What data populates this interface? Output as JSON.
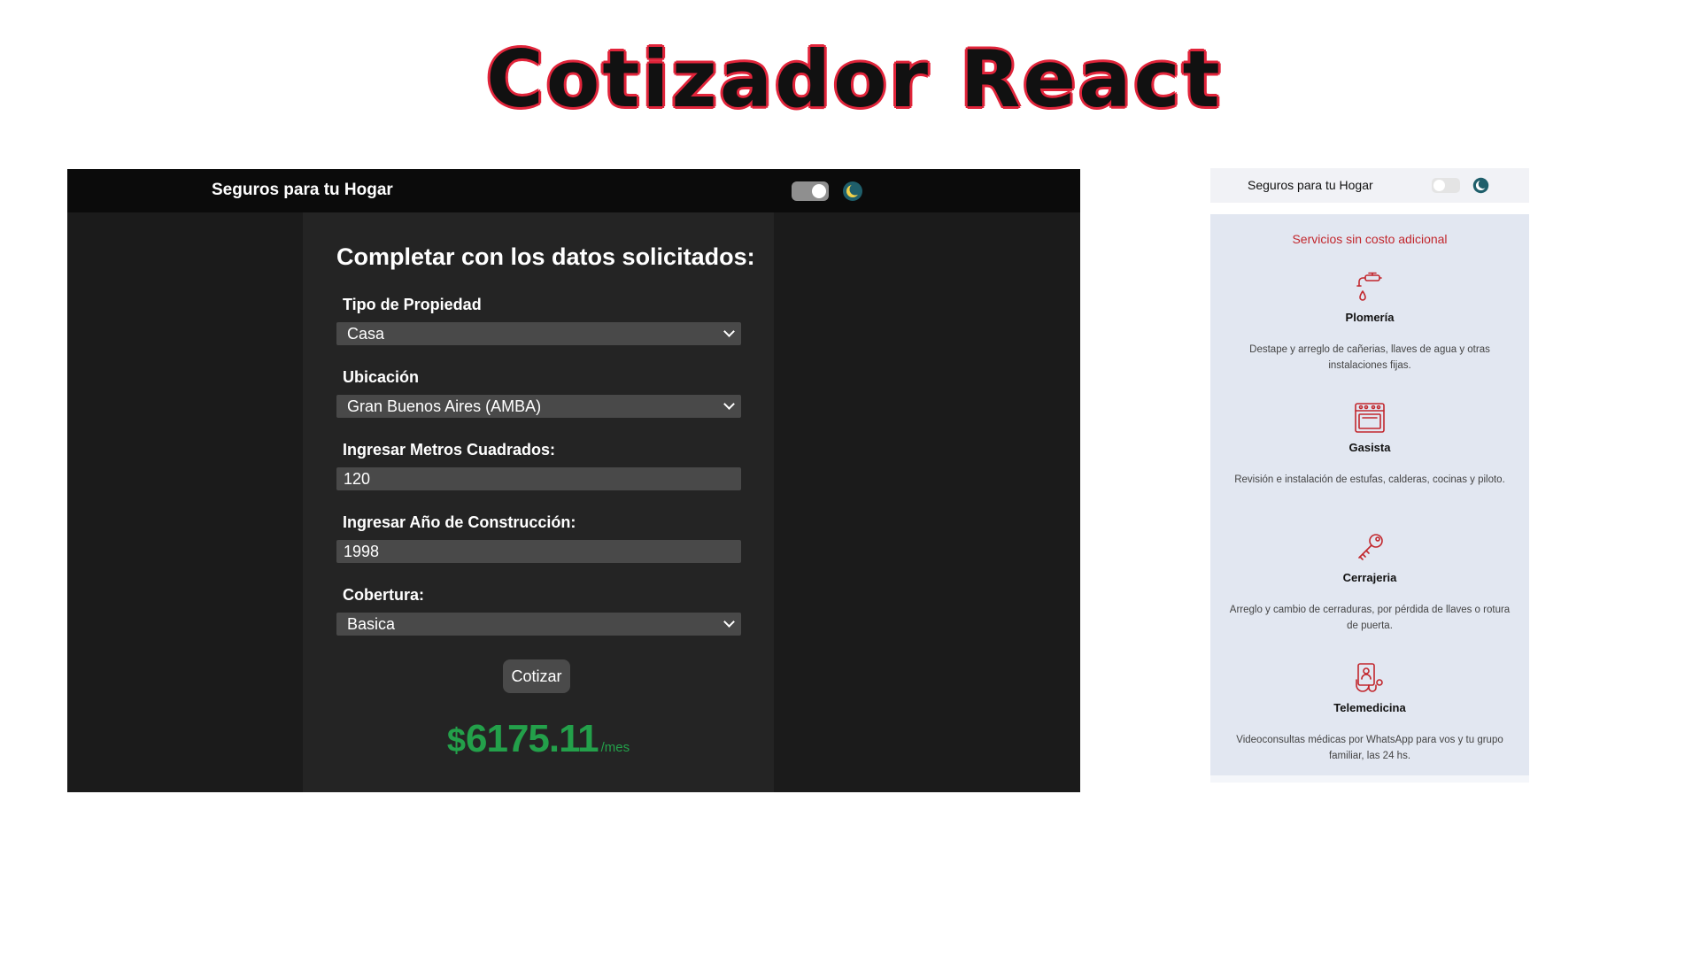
{
  "page_title": "Cotizador React",
  "dark_app": {
    "brand": "Seguros para tu Hogar",
    "form_title": "Completar con los datos solicitados:",
    "fields": [
      {
        "label": "Tipo de Propiedad",
        "value": "Casa",
        "kind": "select"
      },
      {
        "label": "Ubicación",
        "value": "Gran Buenos Aires (AMBA)",
        "kind": "select"
      },
      {
        "label": "Ingresar Metros Cuadrados:",
        "value": "120",
        "kind": "input"
      },
      {
        "label": "Ingresar Año de Construcción:",
        "value": "1998",
        "kind": "input"
      },
      {
        "label": "Cobertura:",
        "value": "Basica",
        "kind": "select"
      }
    ],
    "button_label": "Cotizar",
    "result": {
      "currency": "$",
      "amount": "6175.11",
      "period": "/mes"
    },
    "theme_toggle_on": true,
    "colors": {
      "background": "#1b1b1b",
      "navbar": "#0b0b0b",
      "panel": "#242424",
      "result": "#23a04a"
    }
  },
  "light_app": {
    "brand": "Seguros para tu Hogar",
    "theme_toggle_on": false,
    "services_title": "Servicios sin costo adicional",
    "services": [
      {
        "icon": "faucet-icon",
        "name": "Plomería",
        "desc": "Destape y arreglo de cañerias, llaves de agua y otras instalaciones fijas."
      },
      {
        "icon": "oven-icon",
        "name": "Gasista",
        "desc": "Revisión e instalación de estufas, calderas, cocinas y piloto."
      },
      {
        "icon": "key-icon",
        "name": "Cerrajeria",
        "desc": "Arreglo y cambio de cerraduras, por pérdida de llaves o rotura de puerta."
      },
      {
        "icon": "telemedicine-icon",
        "name": "Telemedicina",
        "desc": "Videoconsultas médicas por WhatsApp para vos y tu grupo familiar, las 24 hs."
      }
    ],
    "colors": {
      "panel": "#e2e7f1",
      "accent": "#c2272d"
    }
  }
}
